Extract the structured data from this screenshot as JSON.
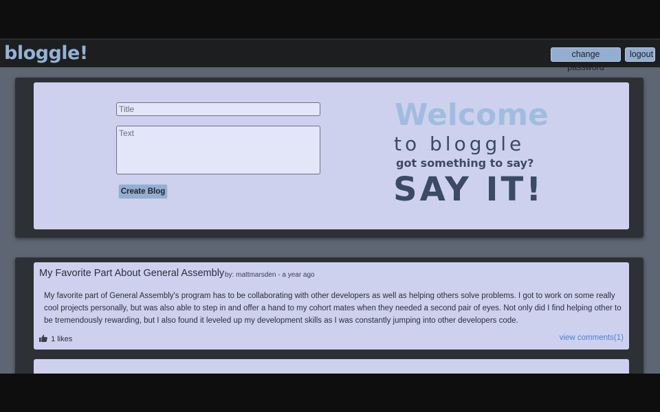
{
  "nav": {
    "brand": "bloggle!",
    "change_password_label": "change password",
    "logout_label": "logout"
  },
  "compose": {
    "title_placeholder": "Title",
    "text_placeholder": "Text",
    "create_label": "Create Blog",
    "welcome_line1": "Welcome",
    "welcome_line2": "to bloggle",
    "welcome_line3": "got something to say?",
    "welcome_line4": "SAY IT!"
  },
  "posts": [
    {
      "title": "My Favorite Part About General Assembly",
      "meta": "by: mattmarsden - a year ago",
      "body": "My favorite part of General Assembly's program has to be collaborating with other developers as well as helping others solve problems. I got to work on some really cool projects personally, but was also able to step in and offer a hand to my cohort mates when they needed a second pair of eyes. Not only did I find helping other to be tremendously rewarding, but I also found it leveled up my development skills as I was constantly jumping into other developers code.",
      "likes": "1 likes",
      "comments_link": "view comments(1)"
    }
  ],
  "colors": {
    "accent_button": "#93aed0",
    "card_bg": "#ced1ee",
    "link": "#4b7ed6",
    "welcome_light": "#a0bde0",
    "welcome_dark": "#3b4a65"
  },
  "icons": {
    "likes": "thumbs-up-icon"
  }
}
